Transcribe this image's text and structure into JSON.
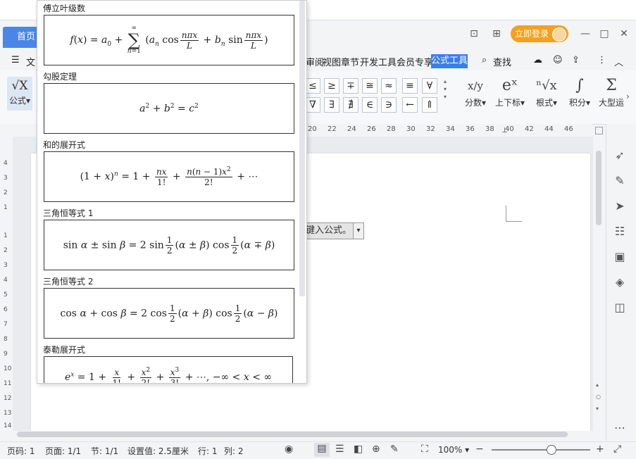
{
  "tabs": {
    "home": "首页"
  },
  "menubar": {
    "file": "文",
    "items": [
      "审阅",
      "视图",
      "章节",
      "开发工具",
      "会员专享"
    ],
    "active": "公式工具",
    "search": "查找"
  },
  "header": {
    "login": "立即登录"
  },
  "ribbon": {
    "formula_label": "公式",
    "formula_icon_text": "√X",
    "symbols_row1": [
      "≤",
      "≥",
      "∓",
      "≅",
      "≈",
      "≡",
      "∀"
    ],
    "symbols_row2": [
      "∇",
      "∃",
      "∄",
      "∈",
      "∋",
      "←",
      "⇑"
    ],
    "tools": [
      {
        "label": "分数",
        "glyph": "x/y"
      },
      {
        "label": "上下标",
        "glyph": "eˣ"
      },
      {
        "label": "根式",
        "glyph": "ⁿ√x"
      },
      {
        "label": "积分",
        "glyph": "∫"
      },
      {
        "label": "大型运",
        "glyph": "Σ"
      }
    ]
  },
  "ruler": {
    "h_ticks": [
      "20",
      "22",
      "24",
      "26",
      "28",
      "30",
      "32",
      "34",
      "36",
      "38",
      "40",
      "42",
      "44",
      "46"
    ],
    "v_ticks": [
      "4",
      "3",
      "2",
      "1",
      "1",
      "2",
      "3",
      "4",
      "5",
      "6",
      "7",
      "8",
      "9",
      "10",
      "11",
      "12",
      "13",
      "14"
    ]
  },
  "document": {
    "formula_placeholder": "键入公式。"
  },
  "dropdown": {
    "sections": [
      {
        "title": "傅立叶级数"
      },
      {
        "title": "勾股定理"
      },
      {
        "title": "和的展开式"
      },
      {
        "title": "三角恒等式 1"
      },
      {
        "title": "三角恒等式 2"
      },
      {
        "title": "泰勒展开式"
      }
    ]
  },
  "status": {
    "page_num": "页码: 1",
    "pages": "页面: 1/1",
    "section": "节: 1/1",
    "setting": "设置值: 2.5厘米",
    "row": "行: 1",
    "col": "列: 2",
    "zoom": "100%",
    "zoom_level": 0.6
  }
}
